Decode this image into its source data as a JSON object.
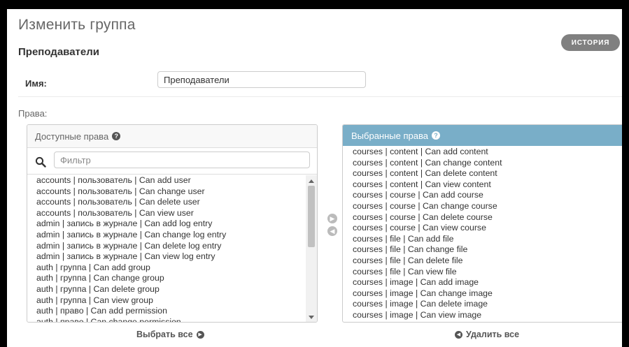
{
  "header": {
    "title": "Изменить группа",
    "object_name": "Преподаватели",
    "history_label": "ИСТОРИЯ"
  },
  "form": {
    "name_label": "Имя:",
    "name_value": "Преподаватели",
    "permissions_label": "Права:"
  },
  "available": {
    "title": "Доступные права",
    "filter_placeholder": "Фильтр",
    "items": [
      "accounts | пользователь | Can add user",
      "accounts | пользователь | Can change user",
      "accounts | пользователь | Can delete user",
      "accounts | пользователь | Can view user",
      "admin | запись в журнале | Can add log entry",
      "admin | запись в журнале | Can change log entry",
      "admin | запись в журнале | Can delete log entry",
      "admin | запись в журнале | Can view log entry",
      "auth | группа | Can add group",
      "auth | группа | Can change group",
      "auth | группа | Can delete group",
      "auth | группа | Can view group",
      "auth | право | Can add permission",
      "auth | право | Can change permission"
    ],
    "choose_all_label": "Выбрать все"
  },
  "chosen": {
    "title": "Выбранные права",
    "items": [
      "courses | content | Can add content",
      "courses | content | Can change content",
      "courses | content | Can delete content",
      "courses | content | Can view content",
      "courses | course | Can add course",
      "courses | course | Can change course",
      "courses | course | Can delete course",
      "courses | course | Can view course",
      "courses | file | Can add file",
      "courses | file | Can change file",
      "courses | file | Can delete file",
      "courses | file | Can view file",
      "courses | image | Can add image",
      "courses | image | Can change image",
      "courses | image | Can delete image",
      "courses | image | Can view image"
    ],
    "remove_all_label": "Удалить все"
  },
  "icons": {
    "help": "question-circle-icon",
    "search": "search-icon",
    "add": "arrow-right-circle-icon",
    "remove": "arrow-left-circle-icon"
  },
  "colors": {
    "chosen_header": "#79aec8",
    "history_button": "#808080"
  }
}
